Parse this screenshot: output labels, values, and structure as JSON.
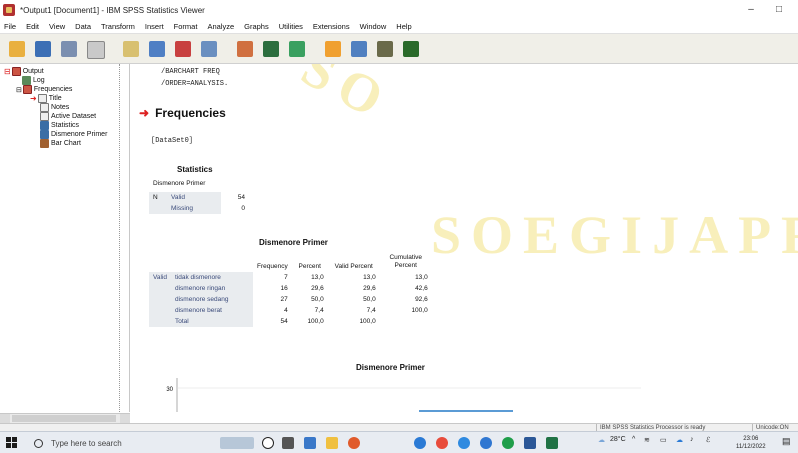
{
  "window": {
    "title": "*Output1 [Document1] - IBM SPSS Statistics Viewer",
    "minimize": "–",
    "maximize": "□"
  },
  "menu": [
    "File",
    "Edit",
    "View",
    "Data",
    "Transform",
    "Insert",
    "Format",
    "Analyze",
    "Graphs",
    "Utilities",
    "Extensions",
    "Window",
    "Help"
  ],
  "toolbar": {
    "icons": [
      "open-icon",
      "save-icon",
      "print-icon",
      "print-preview-icon",
      "export-icon",
      "recall-dialog-icon",
      "undo-icon",
      "redo-icon",
      "goto-data-icon",
      "goto-case-icon",
      "variables-icon",
      "select-cases-icon",
      "show-all-icon",
      "designate-window-icon",
      "run-script-icon"
    ]
  },
  "outline": {
    "items": [
      {
        "label": "Output",
        "icon": "output-book-icon"
      },
      {
        "label": "Log",
        "icon": "log-icon"
      },
      {
        "label": "Frequencies",
        "icon": "output-book-icon"
      },
      {
        "label": "Title",
        "icon": "title-icon"
      },
      {
        "label": "Notes",
        "icon": "notes-icon"
      },
      {
        "label": "Active Dataset",
        "icon": "notes-icon"
      },
      {
        "label": "Statistics",
        "icon": "table-icon"
      },
      {
        "label": "Dismenore Primer",
        "icon": "table-icon"
      },
      {
        "label": "Bar Chart",
        "icon": "bar-chart-icon"
      }
    ]
  },
  "syntax": {
    "line1": "/BARCHART FREQ",
    "line2": "/ORDER=ANALYSIS."
  },
  "section_heading": "Frequencies",
  "dataset_label": "[DataSet0]",
  "watermark": "SOEGIJAPRA",
  "statistics_table": {
    "title": "Statistics",
    "variable": "Dismenore Primer",
    "row_header": "N",
    "rows": [
      {
        "label": "Valid",
        "value": "54"
      },
      {
        "label": "Missing",
        "value": "0"
      }
    ]
  },
  "freq_table": {
    "title": "Dismenore Primer",
    "columns": [
      "Frequency",
      "Percent",
      "Valid Percent",
      "Cumulative Percent"
    ],
    "group_label": "Valid",
    "rows": [
      {
        "label": "tidak dismenore",
        "frequency": "7",
        "percent": "13,0",
        "valid_percent": "13,0",
        "cumulative": "13,0"
      },
      {
        "label": "dismenore ringan",
        "frequency": "16",
        "percent": "29,6",
        "valid_percent": "29,6",
        "cumulative": "42,6"
      },
      {
        "label": "dismenore sedang",
        "frequency": "27",
        "percent": "50,0",
        "valid_percent": "50,0",
        "cumulative": "92,6"
      },
      {
        "label": "dismenore berat",
        "frequency": "4",
        "percent": "7,4",
        "valid_percent": "7,4",
        "cumulative": "100,0"
      },
      {
        "label": "Total",
        "frequency": "54",
        "percent": "100,0",
        "valid_percent": "100,0",
        "cumulative": ""
      }
    ]
  },
  "chart": {
    "title": "Dismenore Primer",
    "y_tick": "30",
    "bar_color": "#5b9bd5"
  },
  "status": {
    "processor": "IBM SPSS Statistics Processor is ready",
    "encoding": "Unicode:ON"
  },
  "taskbar": {
    "search_placeholder": "Type here to search",
    "weather": "28°C",
    "time": "23:06",
    "date": "11/12/2022"
  },
  "colors": {
    "table_shade": "#e9ecef",
    "watermark": "#ebd23c",
    "heading_arrow": "#dd2222"
  }
}
